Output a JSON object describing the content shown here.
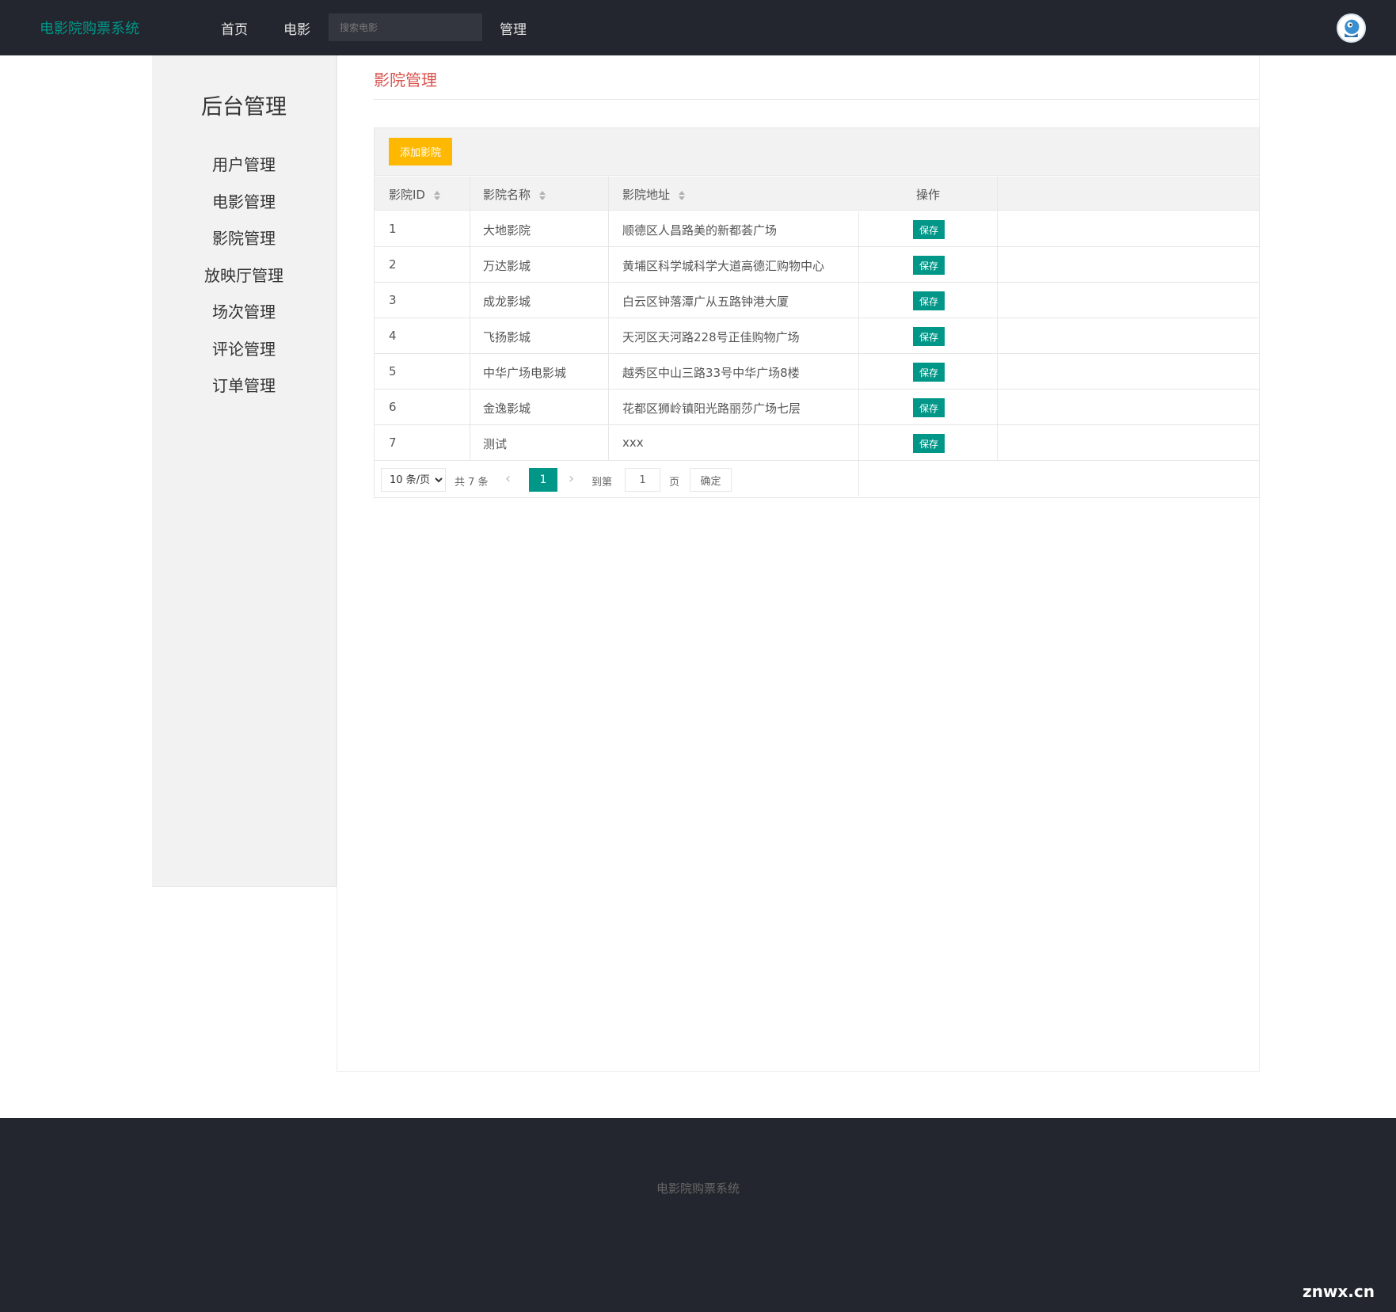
{
  "header": {
    "brand": "电影院购票系统",
    "nav": [
      "首页",
      "电影",
      "管理"
    ],
    "search_placeholder": "搜索电影"
  },
  "sidebar": {
    "title": "后台管理",
    "items": [
      "用户管理",
      "电影管理",
      "影院管理",
      "放映厅管理",
      "场次管理",
      "评论管理",
      "订单管理"
    ]
  },
  "main": {
    "title": "影院管理",
    "add_button": "添加影院",
    "columns": [
      "影院ID",
      "影院名称",
      "影院地址",
      "操作"
    ],
    "action_label": "保存",
    "rows": [
      {
        "id": "1",
        "name": "大地影院",
        "address": "顺德区人昌路美的新都荟广场"
      },
      {
        "id": "2",
        "name": "万达影城",
        "address": "黄埔区科学城科学大道高德汇购物中心"
      },
      {
        "id": "3",
        "name": "成龙影城",
        "address": "白云区钟落潭广从五路钟港大厦"
      },
      {
        "id": "4",
        "name": "飞扬影城",
        "address": "天河区天河路228号正佳购物广场"
      },
      {
        "id": "5",
        "name": "中华广场电影城",
        "address": "越秀区中山三路33号中华广场8楼"
      },
      {
        "id": "6",
        "name": "金逸影城",
        "address": "花都区狮岭镇阳光路丽莎广场七层"
      },
      {
        "id": "7",
        "name": "测试",
        "address": "xxx"
      }
    ]
  },
  "pagination": {
    "page_size": "10 条/页",
    "total": "共 7 条",
    "current_page": "1",
    "goto_label": "到第",
    "page_unit": "页",
    "goto_value": "1",
    "confirm": "确定"
  },
  "footer": {
    "text": "电影院购票系统",
    "watermark": "znwx.cn"
  },
  "colors": {
    "header_bg": "#23262e",
    "brand": "#009688",
    "add_button": "#ffb800",
    "save_button": "#009688",
    "title": "#d9534f"
  }
}
